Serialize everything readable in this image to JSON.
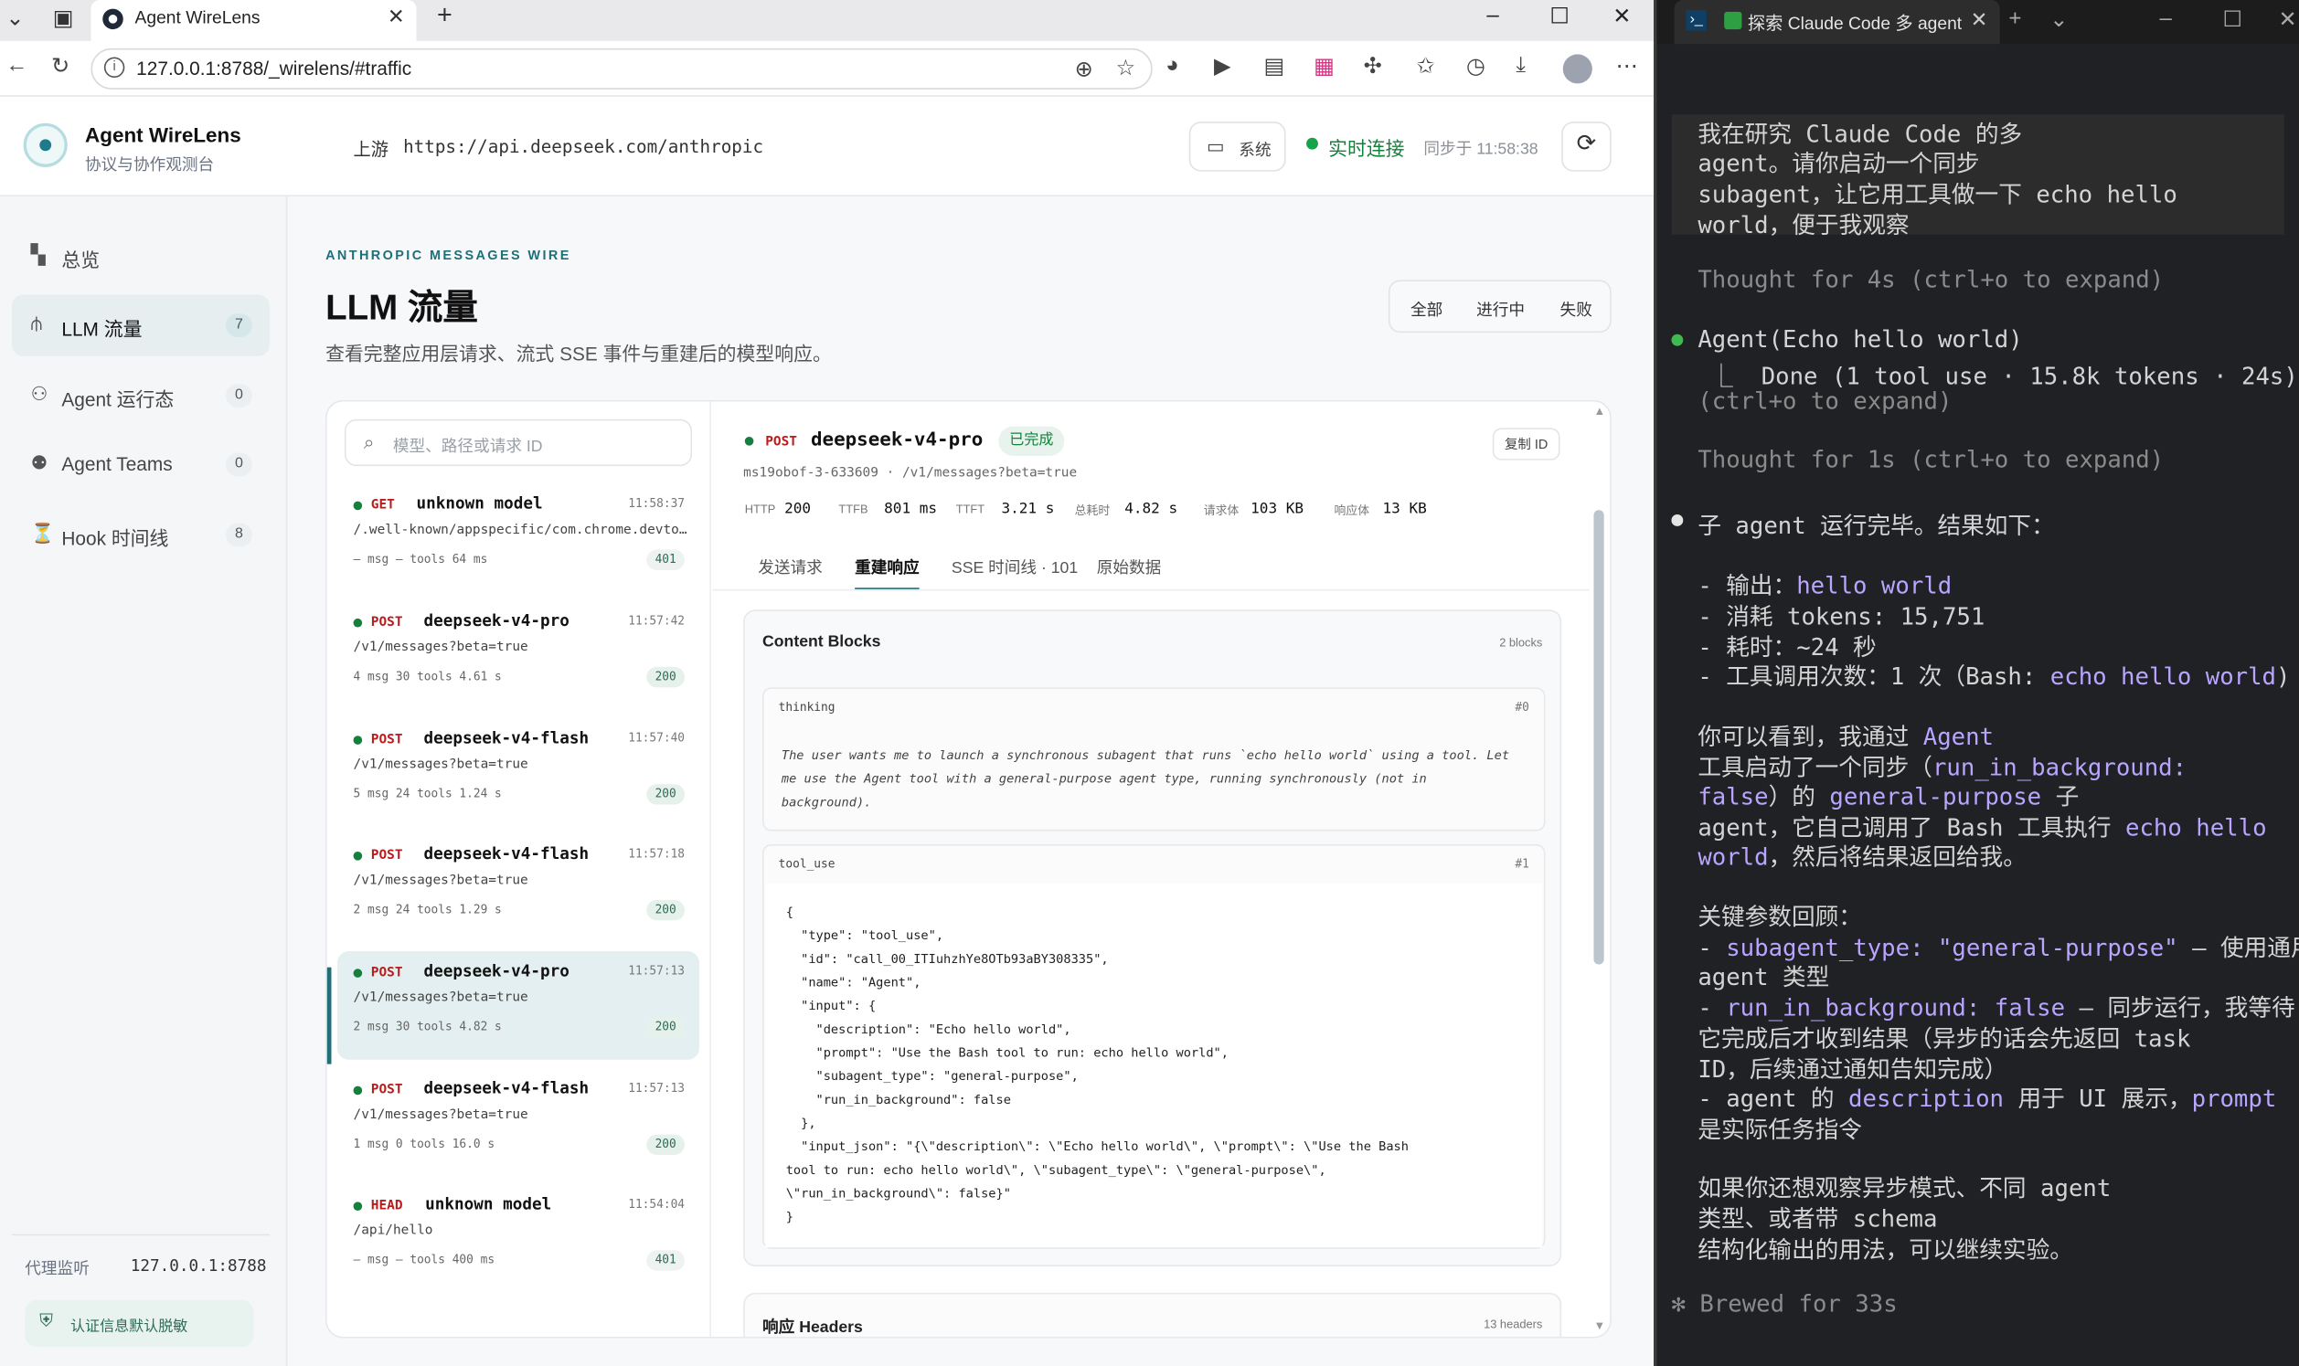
{
  "browser": {
    "tab_title": "Agent WireLens",
    "url": "127.0.0.1:8788/_wirelens/#traffic"
  },
  "app": {
    "name": "Agent WireLens",
    "subtitle": "协议与协作观测台",
    "upstream_label": "上游",
    "upstream_url": "https://api.deepseek.com/anthropic",
    "system_label": "系统",
    "live_label": "实时连接",
    "sync_label": "同步于 11:58:38"
  },
  "sidebar": {
    "items": [
      {
        "icon": "dashboard-icon",
        "label": "总览",
        "count": ""
      },
      {
        "icon": "traffic-icon",
        "label": "LLM 流量",
        "count": "7"
      },
      {
        "icon": "agent-icon",
        "label": "Agent 运行态",
        "count": "0"
      },
      {
        "icon": "team-icon",
        "label": "Agent Teams",
        "count": "0"
      },
      {
        "icon": "hook-icon",
        "label": "Hook 时间线",
        "count": "8"
      }
    ],
    "proxy_label": "代理监听",
    "proxy_value": "127.0.0.1:8788",
    "auth_label": "认证信息默认脱敏"
  },
  "main": {
    "eyebrow": "ANTHROPIC MESSAGES WIRE",
    "title": "LLM 流量",
    "desc": "查看完整应用层请求、流式 SSE 事件与重建后的模型响应。",
    "filters": [
      "全部",
      "进行中",
      "失败"
    ],
    "search_placeholder": "模型、路径或请求 ID"
  },
  "requests": [
    {
      "method": "GET",
      "model": "unknown model",
      "time": "11:58:37",
      "path": "/.well-known/appspecific/com.chrome.devtools.json",
      "stats": "– msg  – tools  64 ms",
      "status": "401"
    },
    {
      "method": "POST",
      "model": "deepseek-v4-pro",
      "time": "11:57:42",
      "path": "/v1/messages?beta=true",
      "stats": "4 msg  30 tools  4.61 s",
      "status": "200"
    },
    {
      "method": "POST",
      "model": "deepseek-v4-flash",
      "time": "11:57:40",
      "path": "/v1/messages?beta=true",
      "stats": "5 msg  24 tools  1.24 s",
      "status": "200"
    },
    {
      "method": "POST",
      "model": "deepseek-v4-flash",
      "time": "11:57:18",
      "path": "/v1/messages?beta=true",
      "stats": "2 msg  24 tools  1.29 s",
      "status": "200"
    },
    {
      "method": "POST",
      "model": "deepseek-v4-pro",
      "time": "11:57:13",
      "path": "/v1/messages?beta=true",
      "stats": "2 msg  30 tools  4.82 s",
      "status": "200"
    },
    {
      "method": "POST",
      "model": "deepseek-v4-flash",
      "time": "11:57:13",
      "path": "/v1/messages?beta=true",
      "stats": "1 msg  0 tools  16.0 s",
      "status": "200"
    },
    {
      "method": "HEAD",
      "model": "unknown model",
      "time": "11:54:04",
      "path": "/api/hello",
      "stats": "– msg  – tools  400 ms",
      "status": "401"
    }
  ],
  "detail": {
    "method": "POST",
    "model": "deepseek-v4-pro",
    "status": "已完成",
    "copy_label": "复制 ID",
    "sub": "ms19obof-3-633609  ·  /v1/messages?beta=true",
    "metrics": [
      {
        "label": "HTTP",
        "value": "200"
      },
      {
        "label": "TTFB",
        "value": "801 ms"
      },
      {
        "label": "TTFT",
        "value": "3.21 s"
      },
      {
        "label": "总耗时",
        "value": "4.82 s"
      },
      {
        "label": "请求体",
        "value": "103 KB"
      },
      {
        "label": "响应体",
        "value": "13 KB"
      }
    ],
    "tabs": [
      "发送请求",
      "重建响应",
      "SSE 时间线 · 101",
      "原始数据"
    ],
    "content_title": "Content Blocks",
    "content_count": "2 blocks",
    "thinking_label": "thinking",
    "thinking_index": "#0",
    "thinking_text": "The user wants me to launch a synchronous subagent that runs `echo hello world` using a tool. Let me use the Agent tool with a general-purpose agent type, running synchronously (not in background).",
    "tool_label": "tool_use",
    "tool_index": "#1",
    "code_lines": [
      "{",
      "  \"type\": \"tool_use\",",
      "  \"id\": \"call_00_ITIuhzhYe8OTb93aBY308335\",",
      "  \"name\": \"Agent\",",
      "  \"input\": {",
      "    \"description\": \"Echo hello world\",",
      "    \"prompt\": \"Use the Bash tool to run: echo hello world\",",
      "    \"subagent_type\": \"general-purpose\",",
      "    \"run_in_background\": false",
      "  },",
      "  \"input_json\": \"{\\\"description\\\": \\\"Echo hello world\\\", \\\"prompt\\\": \\\"Use the Bash",
      "tool to run: echo hello world\\\", \\\"subagent_type\\\": \\\"general-purpose\\\",",
      "\\\"run_in_background\\\": false}\"",
      "}"
    ],
    "headers_title": "响应 Headers",
    "headers_count": "13 headers"
  },
  "terminal": {
    "tab_title": "探索 Claude Code 多 agent",
    "lines": [
      "我在研究 Claude Code 的多",
      "agent。请你启动一个同步",
      "subagent，让它用工具做一下 echo hello",
      "world，便于我观察",
      "Thought for 4s (ctrl+o to expand)",
      "Agent(Echo hello world)",
      "⎿  Done (1 tool use · 15.8k tokens · 24s)",
      "(ctrl+o to expand)",
      "Thought for 1s (ctrl+o to expand)",
      "子 agent 运行完毕。结果如下：",
      "- 输出：",
      "hello world",
      "- 消耗 tokens: 15,751",
      "- 耗时：~24 秒",
      "- 工具调用次数：1 次（Bash: ",
      "echo hello world",
      ")",
      "你可以看到，我通过 ",
      "Agent",
      "工具启动了一个同步（",
      "run_in_background:",
      "false",
      "）的 ",
      "general-purpose",
      " 子",
      "agent，它自己调用了 Bash 工具执行 ",
      "echo hello",
      "world",
      "，然后将结果返回给我。",
      "关键参数回顾：",
      "- ",
      "subagent_type: \"general-purpose\"",
      " — 使用通用",
      "agent 类型",
      "- ",
      "run_in_background: false",
      " — 同步运行，我等待",
      "它完成后才收到结果（异步的话会先返回 task",
      "ID，后续通过通知告知完成）",
      "- agent 的 ",
      "description",
      " 用于 UI 展示，",
      "prompt",
      "是实际任务指令",
      "如果你还想观察异步模式、不同 agent",
      "类型、或者带 schema",
      "结构化输出的用法，可以继续实验。",
      "✻ Brewed for 33s"
    ]
  },
  "colors": {
    "accent": "#1f6f78",
    "live": "#16a34a",
    "method": "#b91c1c",
    "term_bg": "#202124",
    "term_hl": "#b9a5ff"
  }
}
